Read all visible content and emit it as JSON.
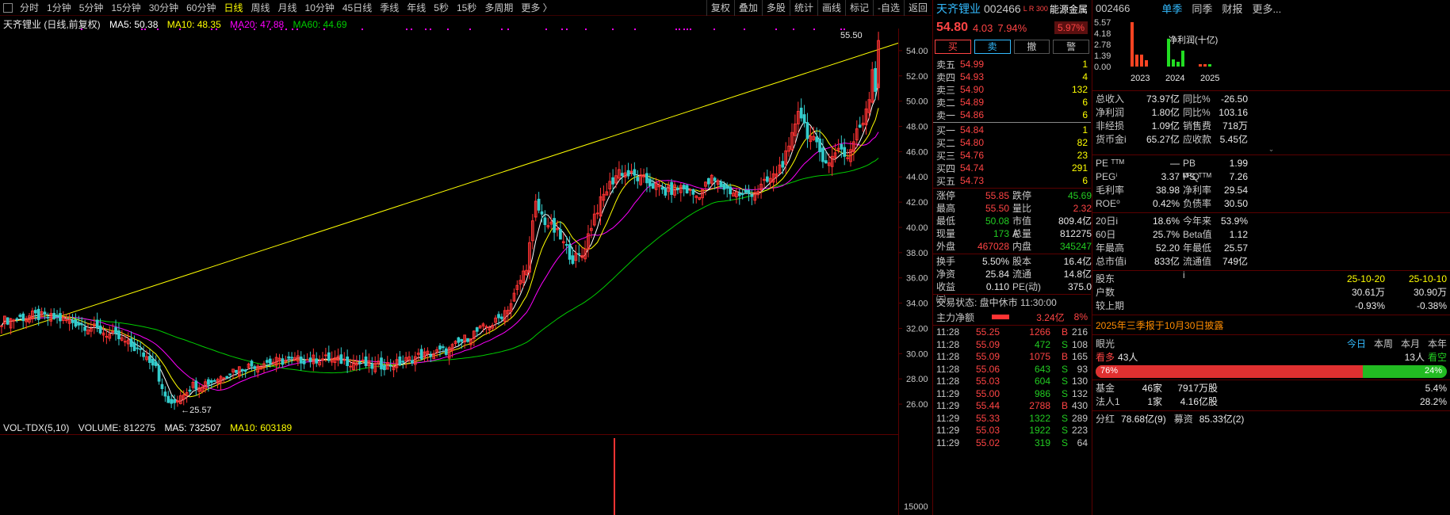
{
  "toolbar": {
    "periods": [
      "分时",
      "1分钟",
      "5分钟",
      "15分钟",
      "30分钟",
      "60分钟",
      "日线",
      "周线",
      "月线",
      "10分钟",
      "45日线",
      "季线",
      "年线",
      "5秒",
      "15秒",
      "多周期",
      "更多 〉"
    ],
    "active_period": "日线",
    "right_buttons": [
      "复权",
      "叠加",
      "多股",
      "统计",
      "画线",
      "标记",
      "-自选",
      "返回"
    ]
  },
  "ma_legend": {
    "title": "天齐锂业 (日线,前复权)",
    "ma5": "MA5: 50.38",
    "ma10": "MA10: 48.35",
    "ma20": "MA20: 47.88",
    "ma60": "MA60: 44.69"
  },
  "colors": {
    "up": "#ff3333",
    "down": "#33cccc",
    "ma5": "#ffffff",
    "ma10": "#ffff00",
    "ma20": "#ff00ff",
    "ma60": "#00cc00",
    "trendline": "#ffff00"
  },
  "chart_data": {
    "type": "candlestick",
    "ylim": [
      25,
      55.5
    ],
    "yticks": [
      26.0,
      28.0,
      30.0,
      32.0,
      34.0,
      36.0,
      38.0,
      40.0,
      42.0,
      44.0,
      46.0,
      48.0,
      50.0,
      52.0,
      54.0
    ],
    "high_label": "55.50",
    "low_label": "25.57",
    "close_anchors": [
      [
        0,
        32.6
      ],
      [
        10,
        33.0
      ],
      [
        18,
        32.8
      ],
      [
        25,
        32.4
      ],
      [
        32,
        31.8
      ],
      [
        38,
        31.2
      ],
      [
        44,
        30.3
      ],
      [
        50,
        29.2
      ],
      [
        52,
        27.0
      ],
      [
        55,
        25.8
      ],
      [
        58,
        26.8
      ],
      [
        62,
        27.5
      ],
      [
        68,
        27.8
      ],
      [
        75,
        28.7
      ],
      [
        85,
        29.3
      ],
      [
        95,
        29.5
      ],
      [
        105,
        29.6
      ],
      [
        115,
        29.3
      ],
      [
        120,
        29.0
      ],
      [
        128,
        29.2
      ],
      [
        135,
        29.8
      ],
      [
        145,
        30.3
      ],
      [
        152,
        31.5
      ],
      [
        160,
        32.5
      ],
      [
        165,
        34.0
      ],
      [
        170,
        37.0
      ],
      [
        173,
        41.8
      ],
      [
        176,
        40.5
      ],
      [
        180,
        39.5
      ],
      [
        185,
        37.5
      ],
      [
        188,
        37.8
      ],
      [
        192,
        41.0
      ],
      [
        196,
        43.0
      ],
      [
        200,
        44.5
      ],
      [
        205,
        44.0
      ],
      [
        210,
        43.5
      ],
      [
        215,
        42.8
      ],
      [
        220,
        43.2
      ],
      [
        225,
        42.5
      ],
      [
        230,
        43.8
      ],
      [
        235,
        43.0
      ],
      [
        240,
        42.5
      ],
      [
        245,
        43.0
      ],
      [
        250,
        44.0
      ],
      [
        255,
        46.0
      ],
      [
        258,
        49.5
      ],
      [
        261,
        47.5
      ],
      [
        265,
        46.0
      ],
      [
        268,
        45.0
      ],
      [
        271,
        46.5
      ],
      [
        274,
        45.5
      ],
      [
        277,
        47.5
      ],
      [
        279,
        48.5
      ],
      [
        281,
        50.5
      ],
      [
        283,
        54.8
      ]
    ],
    "volume_ytick": "15000"
  },
  "volume_legend": {
    "name": "VOL-TDX(5,10)",
    "volume": "VOLUME: 812275",
    "ma5": "MA5: 732507",
    "ma10": "MA10: 603189"
  },
  "quote": {
    "name": "天齐锂业",
    "code": "002466",
    "badge": "L R 300",
    "sector": "能源金属",
    "price": "54.80",
    "change": "4.03",
    "pct": "7.94%",
    "sector_pct": "5.97%",
    "actions": [
      "买",
      "卖",
      "撤",
      "警"
    ],
    "asks": [
      {
        "label": "卖五",
        "price": "54.99",
        "vol": "1"
      },
      {
        "label": "卖四",
        "price": "54.93",
        "vol": "4"
      },
      {
        "label": "卖三",
        "price": "54.90",
        "vol": "132"
      },
      {
        "label": "卖二",
        "price": "54.89",
        "vol": "6"
      },
      {
        "label": "卖一",
        "price": "54.86",
        "vol": "6"
      }
    ],
    "bids": [
      {
        "label": "买一",
        "price": "54.84",
        "vol": "1"
      },
      {
        "label": "买二",
        "price": "54.80",
        "vol": "82"
      },
      {
        "label": "买三",
        "price": "54.76",
        "vol": "23"
      },
      {
        "label": "买四",
        "price": "54.74",
        "vol": "291"
      },
      {
        "label": "买五",
        "price": "54.73",
        "vol": "6"
      }
    ],
    "stats1": [
      [
        "涨停",
        "55.85",
        "red",
        "跌停",
        "45.69",
        "green"
      ],
      [
        "最高",
        "55.50",
        "red",
        "量比",
        "2.32",
        "red"
      ],
      [
        "最低",
        "50.08",
        "green",
        "市值A",
        "809.4亿",
        "white"
      ],
      [
        "现量",
        "173",
        "green",
        "总量",
        "812275",
        "white"
      ],
      [
        "外盘",
        "467028",
        "red",
        "内盘",
        "345247",
        "green"
      ]
    ],
    "stats2": [
      [
        "换手",
        "5.50%",
        "white",
        "股本",
        "16.4亿",
        "white"
      ],
      [
        "净资",
        "25.84",
        "white",
        "流通",
        "14.8亿",
        "white"
      ],
      [
        "收益㈢",
        "0.110",
        "white",
        "PE(动)",
        "375.0",
        "white"
      ]
    ],
    "trade_state": "交易状态: 盘中休市 11:30:00",
    "main_flow": {
      "label": "主力净额",
      "value": "3.24亿",
      "pct": "8%"
    },
    "ticks": [
      [
        "11:28",
        "55.25",
        "1266",
        "B",
        "216"
      ],
      [
        "11:28",
        "55.09",
        "472",
        "S",
        "108"
      ],
      [
        "11:28",
        "55.09",
        "1075",
        "B",
        "165"
      ],
      [
        "11:28",
        "55.06",
        "643",
        "S",
        "93"
      ],
      [
        "11:28",
        "55.03",
        "604",
        "S",
        "130"
      ],
      [
        "11:29",
        "55.00",
        "986",
        "S",
        "132"
      ],
      [
        "11:29",
        "55.44",
        "2788",
        "B",
        "430"
      ],
      [
        "11:29",
        "55.33",
        "1322",
        "S",
        "289"
      ],
      [
        "11:29",
        "55.03",
        "1922",
        "S",
        "223"
      ],
      [
        "11:29",
        "55.02",
        "319",
        "S",
        "64"
      ]
    ]
  },
  "finance": {
    "code": "002466",
    "tabs": [
      "单季",
      "同季",
      "财报",
      "更多..."
    ],
    "active_tab": "单季",
    "mini_chart": {
      "yticks": [
        "5.57",
        "4.18",
        "2.78",
        "1.39",
        "0.00"
      ],
      "title": "净利润(十亿)",
      "years": [
        "2023",
        "2024",
        "2025"
      ]
    },
    "rows1": [
      [
        "总收入",
        "73.97亿",
        "white",
        "同比%",
        "-26.50",
        "white"
      ],
      [
        "净利润",
        "1.80亿",
        "white",
        "同比%",
        "103.16",
        "white"
      ],
      [
        "非经损",
        "1.09亿",
        "white",
        "销售费",
        "718万",
        "white"
      ],
      [
        "货币金i",
        "65.27亿",
        "white",
        "应收款",
        "5.45亿",
        "white"
      ]
    ],
    "rows2": [
      [
        "PE ᵀᵀᴹ",
        "—",
        "white",
        "PB ᴹᴿQ",
        "1.99",
        "white"
      ],
      [
        "PEGⁱ",
        "3.37",
        "white",
        "PS ᵀᵀᴹ",
        "7.26",
        "white"
      ],
      [
        "毛利率",
        "38.98",
        "white",
        "净利率",
        "29.54",
        "white"
      ],
      [
        "ROE⁰",
        "0.42%",
        "white",
        "负债率",
        "30.50",
        "white"
      ]
    ],
    "rows3": [
      [
        "20日i",
        "18.6%",
        "white",
        "今年来",
        "53.9%",
        "white"
      ],
      [
        "60日",
        "25.7%",
        "white",
        "Beta值",
        "1.12",
        "white"
      ],
      [
        "年最高",
        "52.20",
        "white",
        "年最低",
        "25.57",
        "white"
      ],
      [
        "总市值i",
        "833亿",
        "white",
        "流通值i",
        "749亿",
        "white"
      ]
    ],
    "holders": {
      "label": "股东",
      "date1": "25-10-20",
      "date2": "25-10-10",
      "rows": [
        [
          "户数",
          "30.61万",
          "30.90万"
        ],
        [
          "较上期",
          "-0.93%",
          "-0.38%"
        ]
      ]
    },
    "banner": "2025年三季报于10月30日披露",
    "eye": {
      "label": "眼光",
      "tabs": [
        "今日",
        "本周",
        "本月",
        "本年"
      ],
      "active_tab": "今日",
      "bull_label": "看多",
      "bull_count": "43人",
      "bear_count": "13人",
      "bear_label": "看空",
      "bull_pct": "76%",
      "bear_pct": "24%",
      "bull_fraction": 0.76
    },
    "rows4": [
      [
        "基金",
        "46家",
        "7917万股",
        "5.4%"
      ],
      [
        "法人1",
        "1家",
        "4.16亿股",
        "28.2%"
      ]
    ],
    "bottom": {
      "label1": "分红",
      "v1": "78.68亿(9)",
      "label2": "募资",
      "v2": "85.33亿(2)"
    }
  }
}
